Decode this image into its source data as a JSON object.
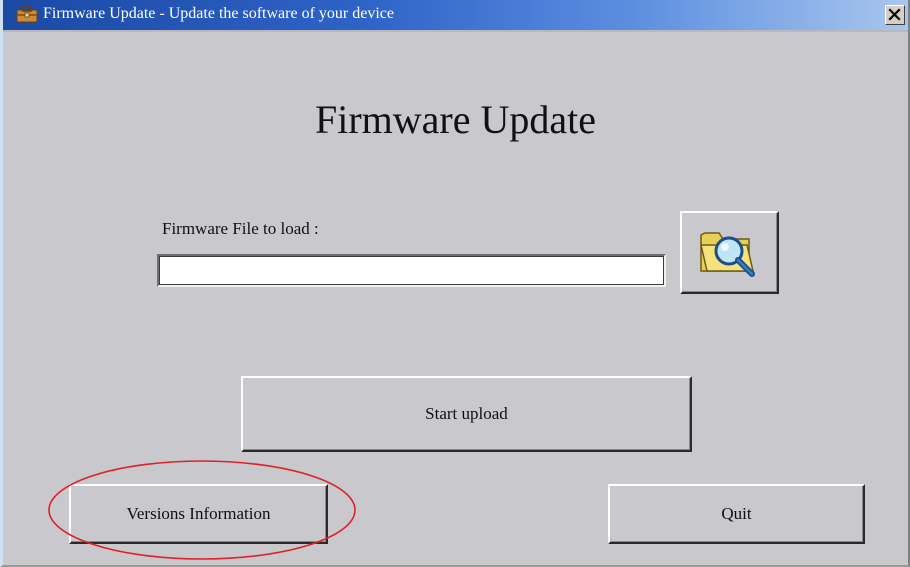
{
  "window": {
    "title": "Firmware Update - Update the software of your device",
    "close_label": "×"
  },
  "main": {
    "heading": "Firmware Update",
    "file_label": "Firmware File to load :",
    "file_value": "",
    "browse_icon": "folder-search-icon",
    "start_label": "Start upload",
    "versions_label": "Versions Information",
    "quit_label": "Quit"
  },
  "annotation": {
    "highlight_target": "Versions Information",
    "color": "#e0202a"
  },
  "colors": {
    "dialog_bg": "#c9c8cc",
    "titlebar_start": "#1b49a4",
    "titlebar_end": "#a9c6ee"
  }
}
